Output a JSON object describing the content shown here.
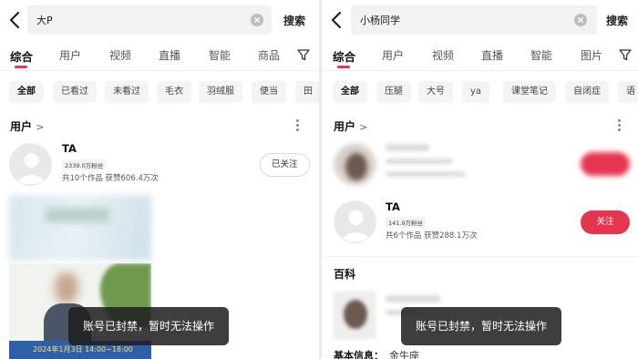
{
  "left": {
    "search": {
      "query": "大P",
      "submit_label": "搜索"
    },
    "tabs": [
      "综合",
      "用户",
      "视频",
      "直播",
      "智能",
      "商品"
    ],
    "chips": [
      "全部",
      "已看过",
      "未看过",
      "毛衣",
      "羽绒服",
      "便当",
      "田"
    ],
    "user_section": {
      "title": "用户",
      "chevron": ">"
    },
    "user": {
      "name": "TA",
      "fans": "2339.0万粉丝",
      "stats": "共10个作品 获赞606.4万次",
      "follow_label": "已关注"
    },
    "video_caption": "2024年1月3日 14:00~18:00",
    "toast": "账号已封禁，暂时无法操作"
  },
  "right": {
    "search": {
      "query": "小杨同学",
      "submit_label": "搜索"
    },
    "tabs": [
      "综合",
      "用户",
      "视频",
      "直播",
      "智能",
      "图片"
    ],
    "chips": [
      "全部",
      "压腿",
      "大号",
      "ya",
      "课堂笔记",
      "自闭症",
      "语"
    ],
    "user_section": {
      "title": "用户",
      "chevron": ">"
    },
    "user": {
      "name": "TA",
      "fans": "141.9万粉丝",
      "stats": "共6个作品 获赞288.1万次",
      "follow_label": "关注"
    },
    "baike_title": "百科",
    "info_label": "基本信息：",
    "info_value": "金牛座",
    "toast": "账号已封禁，暂时无法操作"
  },
  "colors": {
    "accent": "#e6354f",
    "toast_bg": "#1e1e1e"
  },
  "icons": [
    "back-arrow-icon",
    "clear-icon",
    "filter-icon",
    "more-icon",
    "avatar-placeholder-icon"
  ]
}
